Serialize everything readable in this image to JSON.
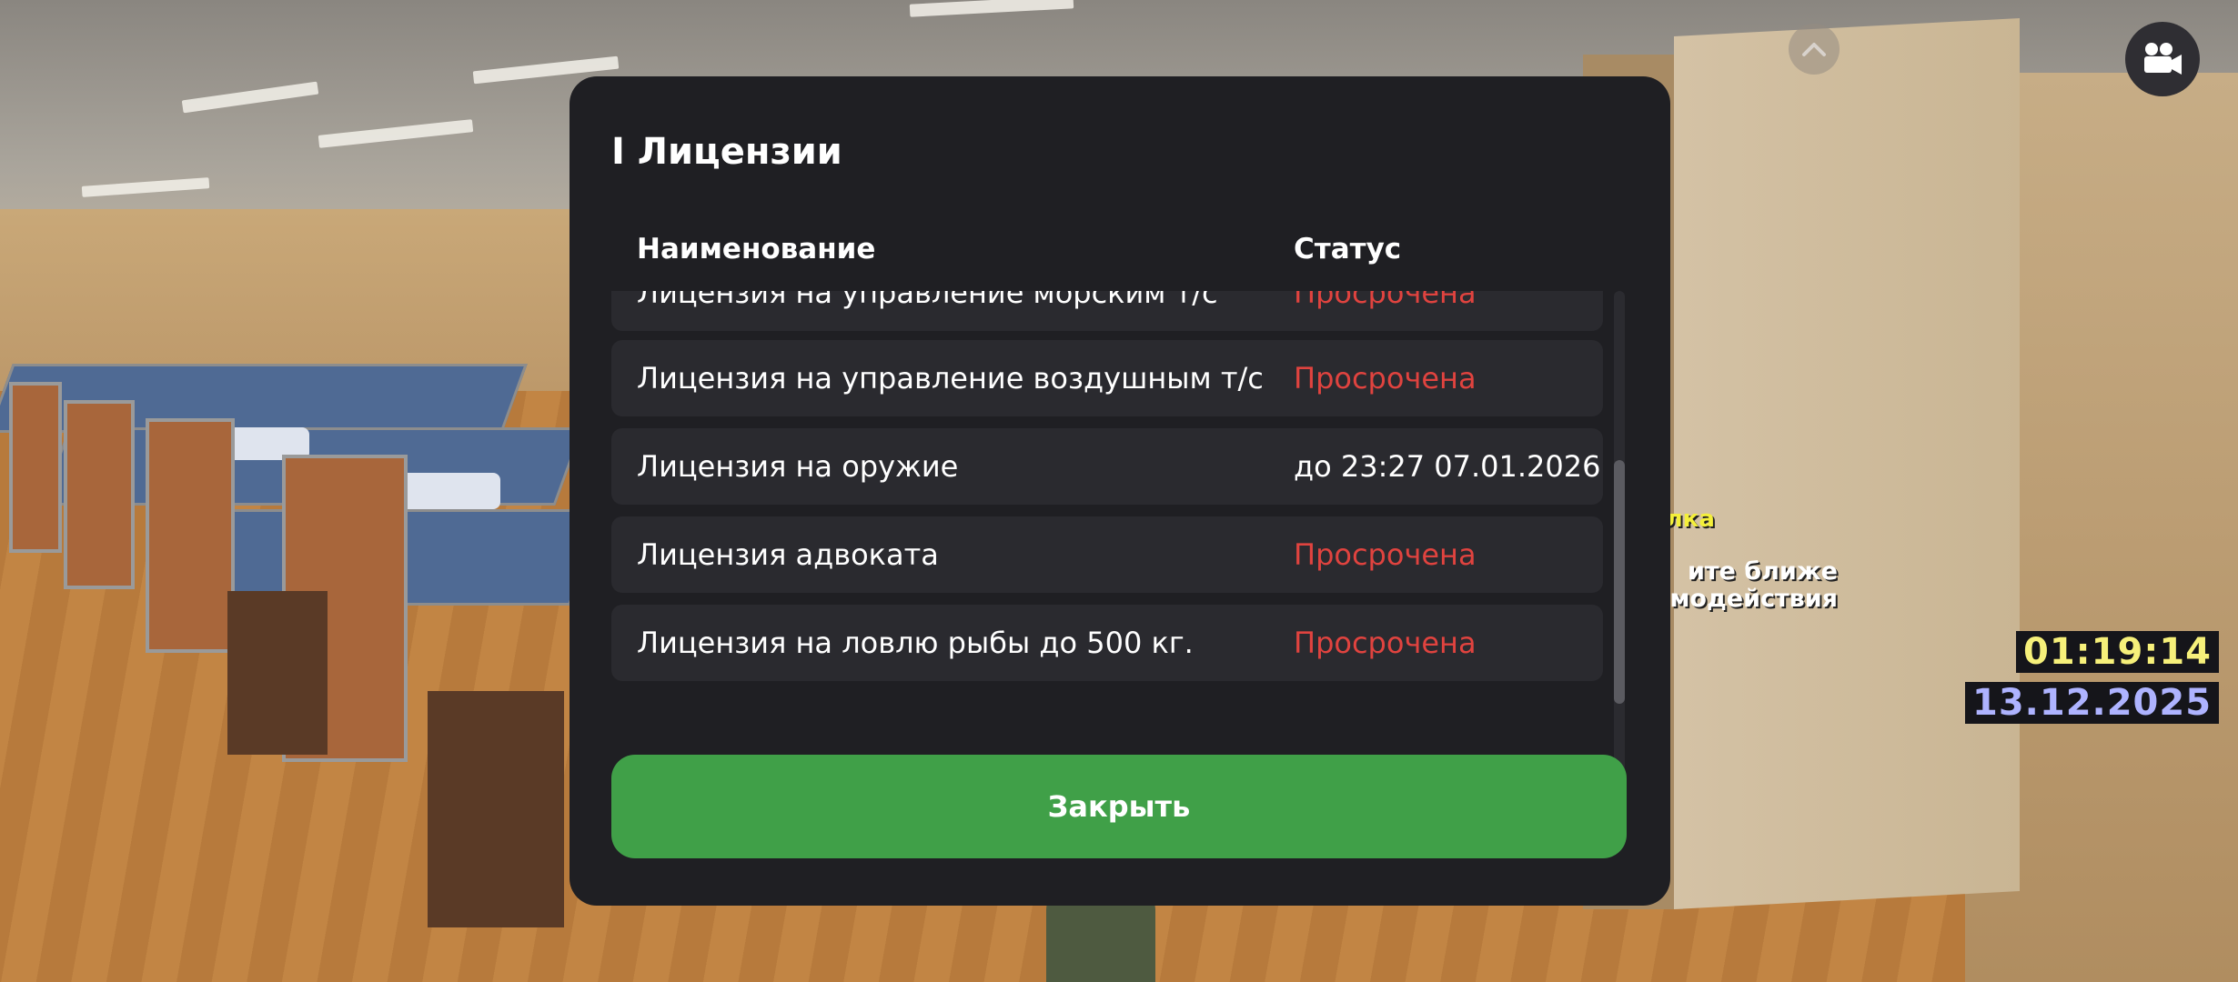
{
  "modal": {
    "title": "I Лицензии",
    "columns": {
      "name": "Наименование",
      "status": "Статус"
    },
    "rows": [
      {
        "name": "Лицензия на управление морским т/с",
        "status": "Просрочена",
        "state": "expired"
      },
      {
        "name": "Лицензия на управление воздушным т/с",
        "status": "Просрочена",
        "state": "expired"
      },
      {
        "name": "Лицензия на оружие",
        "status": "до 23:27 07.01.2026",
        "state": "active"
      },
      {
        "name": "Лицензия адвоката",
        "status": "Просрочена",
        "state": "expired"
      },
      {
        "name": "Лицензия на ловлю рыбы до 500 кг.",
        "status": "Просрочена",
        "state": "expired"
      }
    ],
    "close_label": "Закрыть"
  },
  "hud": {
    "sign_top": "девалка",
    "sign_line1": "ите ближе",
    "sign_line2": "имодействия",
    "time": "01:19:14",
    "date": "13.12.2025",
    "camera_icon": "video-camera-icon",
    "up_icon": "chevron-up-icon"
  },
  "colors": {
    "modal_bg": "#1f1f23",
    "row_bg": "#2a2a2f",
    "expired": "#e0433f",
    "close_button": "#40a048"
  }
}
